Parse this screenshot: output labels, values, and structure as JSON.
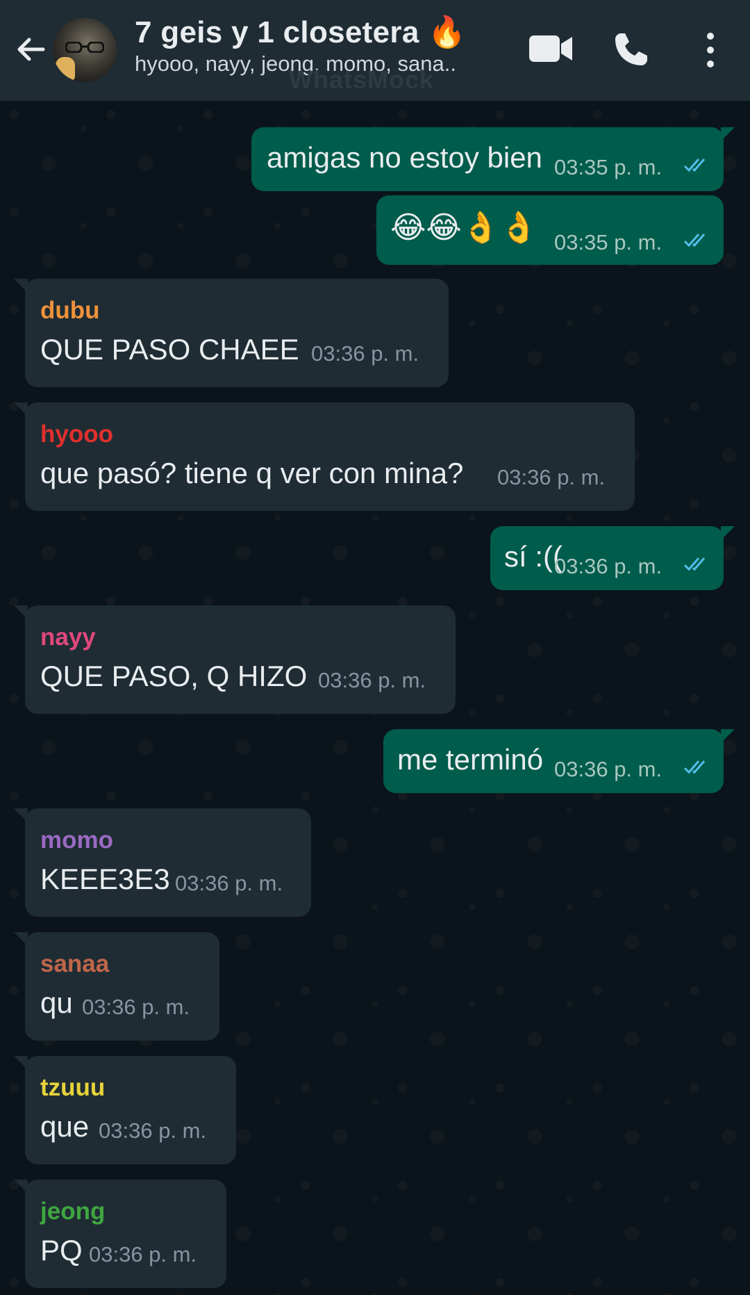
{
  "header": {
    "title": "7 geis y 1 closetera 🔥",
    "subtitle": "hyooo, nayy, jeong, momo, sana..",
    "watermark": "WhatsMock",
    "icons": [
      "back-arrow-icon",
      "video-call-icon",
      "voice-call-icon",
      "more-options-icon"
    ]
  },
  "colors": {
    "header_bg": "#1f2c34",
    "chat_bg": "#0b141a",
    "outgoing_bubble": "#005c4b",
    "incoming_bubble": "#1f2c34",
    "read_ticks": "#53bdeb"
  },
  "messages": [
    {
      "dir": "out",
      "text": "amigas no estoy bien",
      "time": "03:35 p. m."
    },
    {
      "dir": "out",
      "text": "😂😂👌👌",
      "time": "03:35 p. m."
    },
    {
      "dir": "in",
      "sender": "dubu",
      "sender_color": "#f0923b",
      "text": "QUE PASO CHAEE",
      "time": "03:36 p. m."
    },
    {
      "dir": "in",
      "sender": "hyooo",
      "sender_color": "#e0302d",
      "text": "que pasó? tiene q ver con mina?",
      "time": "03:36 p. m."
    },
    {
      "dir": "out",
      "text": "sí :((",
      "time": "03:36 p. m."
    },
    {
      "dir": "in",
      "sender": "nayy",
      "sender_color": "#e0487c",
      "text": "QUE PASO, Q HIZO",
      "time": "03:36 p. m."
    },
    {
      "dir": "out",
      "text": "me terminó",
      "time": "03:36 p. m."
    },
    {
      "dir": "in",
      "sender": "momo",
      "sender_color": "#9a6ac2",
      "text": "KEEE3E3",
      "time": "03:36 p. m."
    },
    {
      "dir": "in",
      "sender": "sanaa",
      "sender_color": "#c1664b",
      "text": "qu",
      "time": "03:36 p. m."
    },
    {
      "dir": "in",
      "sender": "tzuuu",
      "sender_color": "#e6d33a",
      "text": "que",
      "time": "03:36 p. m."
    },
    {
      "dir": "in",
      "sender": "jeong",
      "sender_color": "#3fa63f",
      "text": "PQ",
      "time": "03:36 p. m."
    }
  ]
}
